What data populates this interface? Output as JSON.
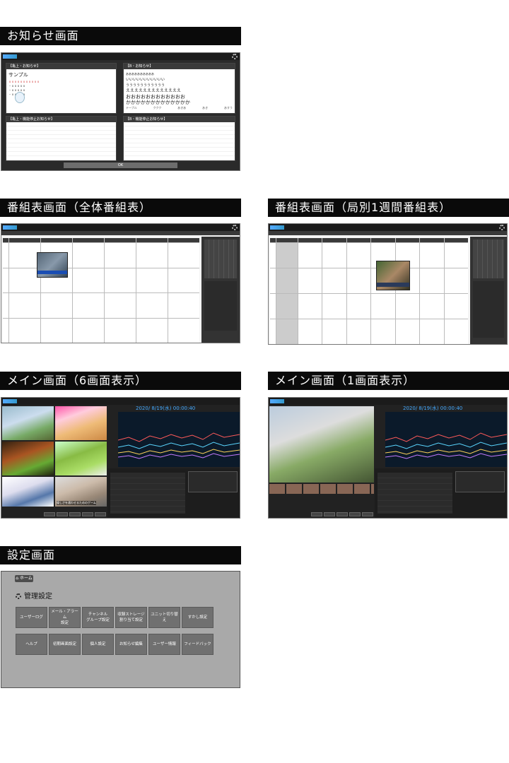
{
  "sections": {
    "notice": "お知らせ画面",
    "program_all": "番組表画面（全体番組表）",
    "program_week": "番組表画面（局別1週間番組表）",
    "main6": "メイン画面（6画面表示）",
    "main1": "メイン画面（1画面表示）",
    "settings": "設定画面"
  },
  "notice_screen": {
    "top_left_title": "【亀上・お知らせ】",
    "top_right_title": "【B・お知らせ】",
    "sample_heading": "サンプル",
    "sample_lines": [
      "ｘｘｘｘｘｘｘｘｘｘｘ",
      "・ｘｘｘｘｘ",
      "・ｘｘｘｘｘ",
      "・ｘｘｘｘｘ"
    ],
    "right_lines": [
      "ああああああああああ",
      "いいいいいいいいいいい",
      "ううううううううううう",
      "えええええええええええええ",
      "おおおおおおおおおおおお",
      "かかかかかかかかかかかかか"
    ],
    "right_footer": [
      "テーブル",
      "ククク",
      "あきあ",
      "あき",
      "あすう"
    ],
    "bottom_left_title": "【亀上・機能停止お知らせ】",
    "bottom_right_title": "【B・機能停止お知らせ】",
    "ok_label": "OK"
  },
  "main_screen": {
    "datetime": "2020/ 8/19(水) 00:00:40",
    "channel_num": "04",
    "caption": "優しさを通わせるためのゲーム",
    "thumb_label": "秀樹・鼻吉・海外"
  },
  "settings_screen": {
    "home": "ホーム",
    "title": "管理設定",
    "row1": [
      "ユーザーログ",
      "メール・アラーム\n設定",
      "チャンネル\nグループ設定",
      "収録ストレージ\n割り当て設定",
      "ユニット切り替え",
      "すかし設定"
    ],
    "row2": [
      "ヘルプ",
      "初期画面設定",
      "個人設定",
      "お知らせ編集",
      "ユーザー情報",
      "フィードバック"
    ]
  },
  "colors": {
    "header_bg": "#0a0a0a",
    "dark_ui": "#2a2a2a",
    "accent": "#3aa0ff",
    "settings_bg": "#a9a9a9",
    "settings_button": "#707070"
  }
}
